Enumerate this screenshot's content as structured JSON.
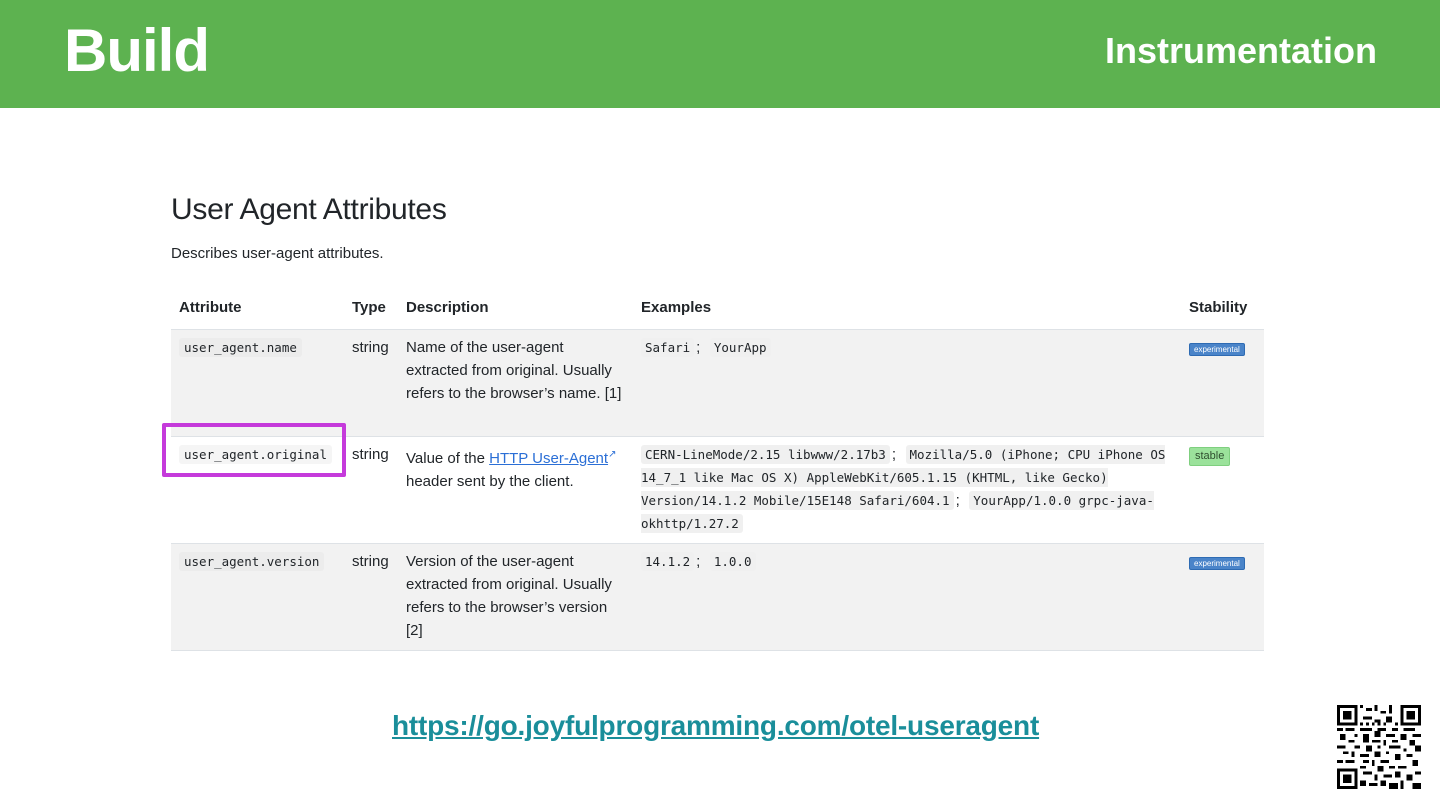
{
  "banner": {
    "title": "Build",
    "section": "Instrumentation",
    "color": "#5db250"
  },
  "page": {
    "heading": "User Agent Attributes",
    "subtext": "Describes user-agent attributes."
  },
  "table": {
    "headers": [
      "Attribute",
      "Type",
      "Description",
      "Examples",
      "Stability"
    ],
    "rows": [
      {
        "attribute": "user_agent.name",
        "type": "string",
        "description": "Name of the user-agent extracted from original. Usually refers to the browser’s name. [1]",
        "examples": [
          "Safari",
          "YourApp"
        ],
        "stability": "experimental"
      },
      {
        "attribute": "user_agent.original",
        "type": "string",
        "description_prefix": "Value of the",
        "description_link": "HTTP User-Agent",
        "description_suffix": "header sent by the client.",
        "examples": [
          "CERN-LineMode/2.15 libwww/2.17b3",
          "Mozilla/5.0 (iPhone; CPU iPhone OS 14_7_1 like Mac OS X) AppleWebKit/605.1.15 (KHTML, like Gecko) Version/14.1.2 Mobile/15E148 Safari/604.1",
          "YourApp/1.0.0 grpc-java-okhttp/1.27.2"
        ],
        "stability": "stable"
      },
      {
        "attribute": "user_agent.version",
        "type": "string",
        "description": "Version of the user-agent extracted from original. Usually refers to the browser’s version [2]",
        "examples": [
          "14.1.2",
          "1.0.0"
        ],
        "stability": "experimental"
      }
    ],
    "separator": ";"
  },
  "highlight_color": "#c53adb",
  "footer": {
    "link": "https://go.joyfulprogramming.com/otel-useragent",
    "qr_icon": "qr-code-icon"
  }
}
